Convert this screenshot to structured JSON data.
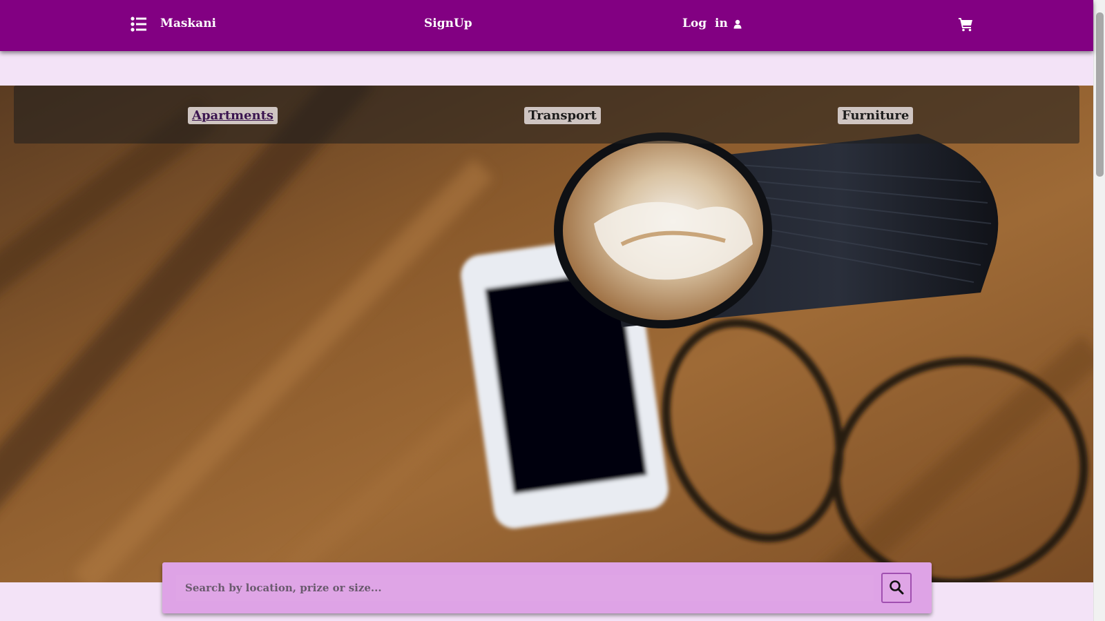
{
  "nav": {
    "brand": "Maskani",
    "signup": "SignUp",
    "login": "Log  in",
    "icons": [
      "list-icon",
      "user-icon",
      "shopping-cart-icon"
    ]
  },
  "categories": [
    {
      "label": "Apartments",
      "active": true
    },
    {
      "label": "Transport",
      "active": false
    },
    {
      "label": "Furniture",
      "active": false
    }
  ],
  "search": {
    "placeholder": "Search by location, prize or size...",
    "value": "",
    "button_icon": "search-icon"
  },
  "hero": {
    "image": "coffee cup, smartphone and glasses on wooden table"
  },
  "colors": {
    "nav_bg": "#820082",
    "page_bg": "#f3e3f7",
    "search_bg": "#dea3e6",
    "category_chip": "#cfc5c2"
  }
}
